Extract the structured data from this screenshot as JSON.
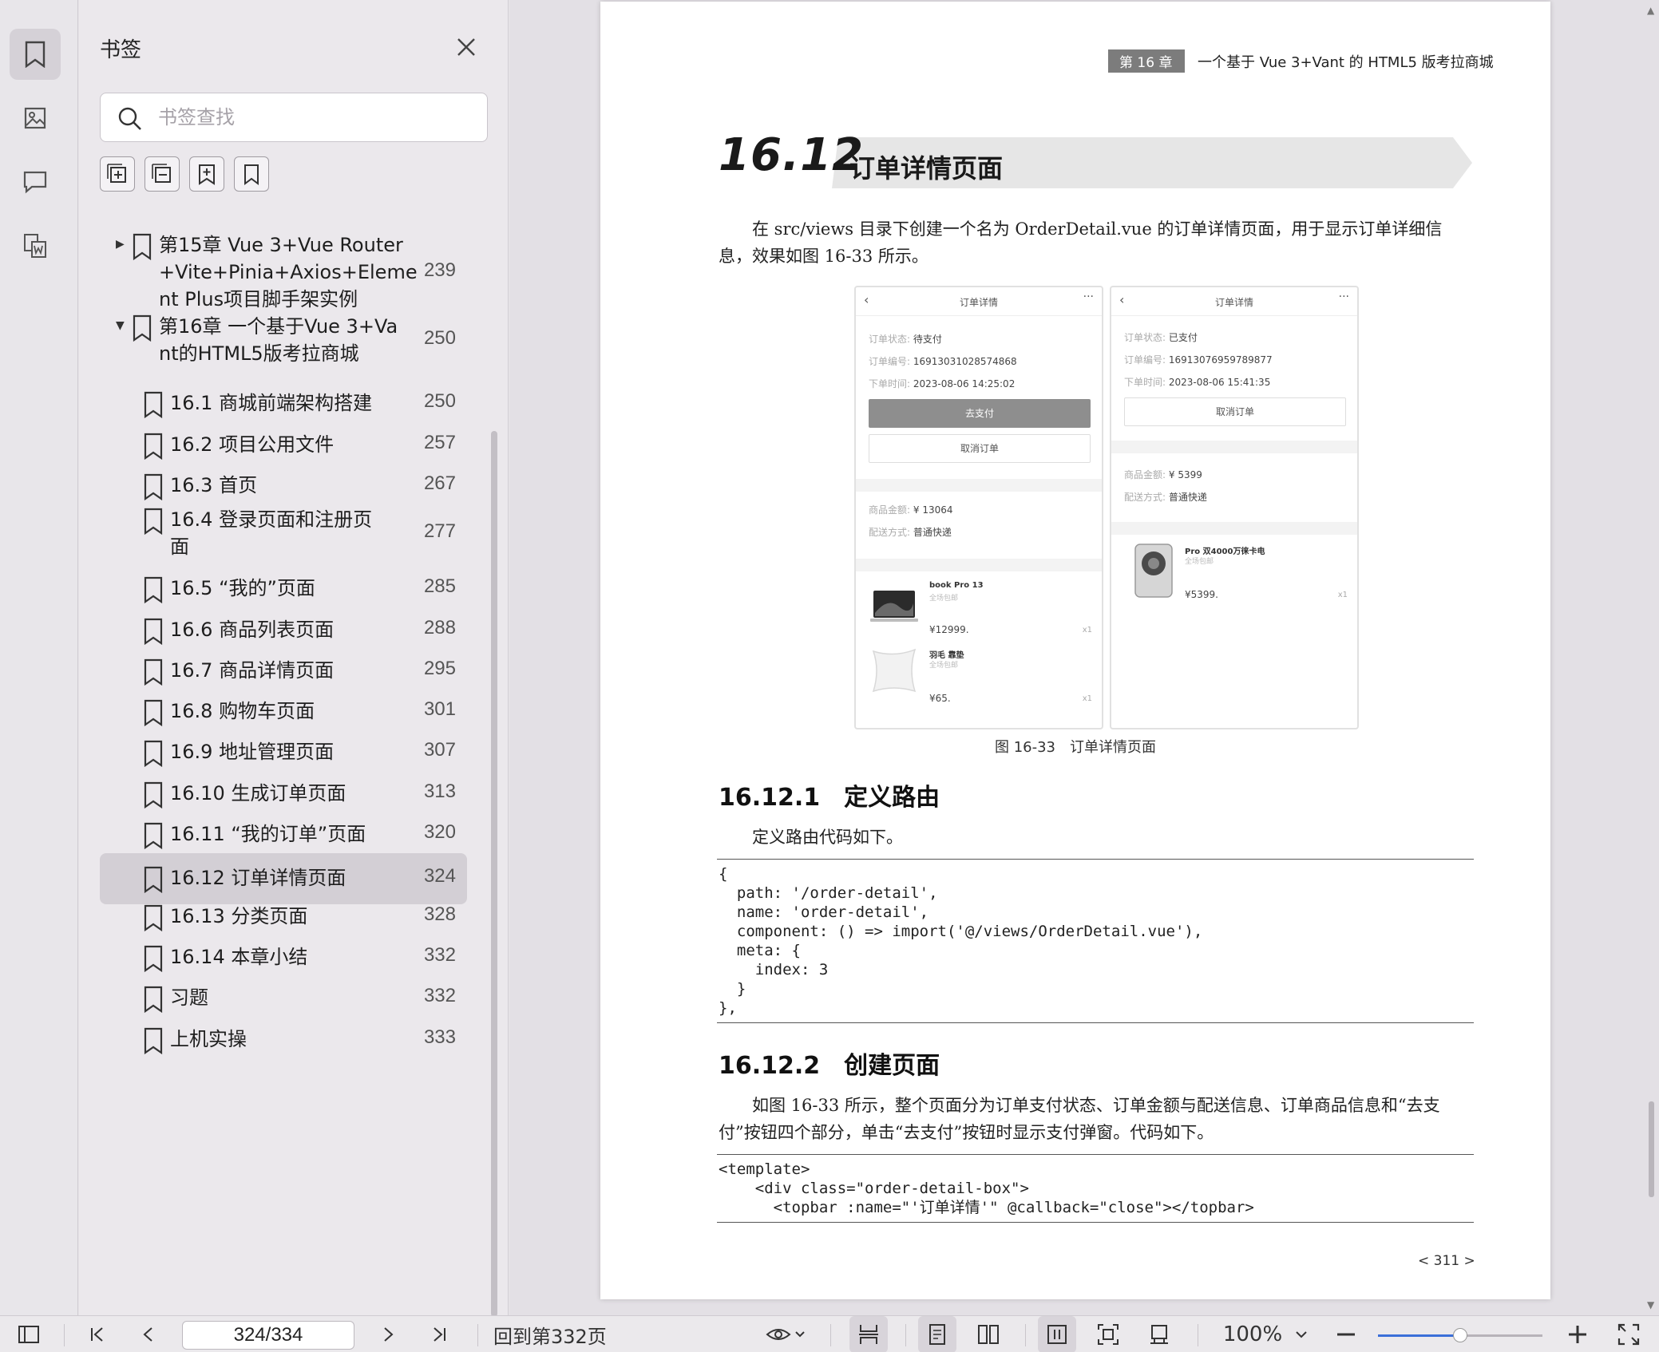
{
  "sidebar": {
    "title": "书签",
    "search_placeholder": "书签查找",
    "rail_icons": [
      "bookmark-icon",
      "image-icon",
      "comment-icon",
      "word-convert-icon"
    ],
    "tool_icons": [
      "expand-all-icon",
      "collapse-all-icon",
      "add-bookmark-icon",
      "bookmark-icon"
    ],
    "items": [
      {
        "level": 0,
        "toggle": "collapsed",
        "lines": [
          "第15章 Vue 3+Vue Router",
          "+Vite+Pinia+Axios+Eleme",
          "nt Plus项目脚手架实例"
        ],
        "page": "239"
      },
      {
        "level": 0,
        "toggle": "expanded",
        "lines": [
          "第16章 一个基于Vue 3+Va",
          "nt的HTML5版考拉商城"
        ],
        "page": "250"
      },
      {
        "level": 1,
        "lines": [
          "16.1 商城前端架构搭建"
        ],
        "page": "250"
      },
      {
        "level": 1,
        "lines": [
          "16.2 项目公用文件"
        ],
        "page": "257"
      },
      {
        "level": 1,
        "lines": [
          "16.3 首页"
        ],
        "page": "267"
      },
      {
        "level": 1,
        "lines": [
          "16.4 登录页面和注册页",
          "面"
        ],
        "page": "277"
      },
      {
        "level": 1,
        "lines": [
          "16.5 “我的”页面"
        ],
        "page": "285"
      },
      {
        "level": 1,
        "lines": [
          "16.6 商品列表页面"
        ],
        "page": "288"
      },
      {
        "level": 1,
        "lines": [
          "16.7 商品详情页面"
        ],
        "page": "295"
      },
      {
        "level": 1,
        "lines": [
          "16.8 购物车页面"
        ],
        "page": "301"
      },
      {
        "level": 1,
        "lines": [
          "16.9 地址管理页面"
        ],
        "page": "307"
      },
      {
        "level": 1,
        "lines": [
          "16.10 生成订单页面"
        ],
        "page": "313"
      },
      {
        "level": 1,
        "lines": [
          "16.11 “我的订单”页面"
        ],
        "page": "320"
      },
      {
        "level": 1,
        "lines": [
          "16.12 订单详情页面"
        ],
        "page": "324",
        "active": true
      },
      {
        "level": 1,
        "lines": [
          "16.13 分类页面"
        ],
        "page": "328"
      },
      {
        "level": 1,
        "lines": [
          "16.14 本章小结"
        ],
        "page": "332"
      },
      {
        "level": 1,
        "lines": [
          "习题"
        ],
        "page": "332"
      },
      {
        "level": 1,
        "lines": [
          "上机实操"
        ],
        "page": "333"
      }
    ]
  },
  "page": {
    "chapter_tag": "第 16 章",
    "header_title": "一个基于 Vue 3+Vant 的 HTML5 版考拉商城",
    "section_number": "16.12",
    "section_title": "订单详情页面",
    "intro": "在 src/views 目录下创建一个名为 OrderDetail.vue 的订单详情页面，用于显示订单详细信息，效果如图 16-33 所示。",
    "figure": {
      "caption": "图 16-33　订单详情页面",
      "left": {
        "title": "订单详情",
        "status_k": "订单状态:",
        "status_v": "待支付",
        "no_k": "订单编号:",
        "no_v": "16913031028574868",
        "time_k": "下单时间:",
        "time_v": "2023-08-06 14:25:02",
        "pay": "去支付",
        "cancel": "取消订单",
        "amount_k": "商品金额:",
        "amount_v": "¥ 13064",
        "ship_k": "配送方式:",
        "ship_v": "普通快递",
        "goods": [
          {
            "name": "book Pro 13",
            "sub": "全场包邮",
            "price": "¥12999.",
            "qty": "x1"
          },
          {
            "name": "羽毛 靠垫",
            "sub": "全场包邮",
            "price": "¥65.",
            "qty": "x1"
          }
        ]
      },
      "right": {
        "title": "订单详情",
        "status_k": "订单状态:",
        "status_v": "已支付",
        "no_k": "订单编号:",
        "no_v": "16913076959789877",
        "time_k": "下单时间:",
        "time_v": "2023-08-06 15:41:35",
        "cancel": "取消订单",
        "amount_k": "商品金额:",
        "amount_v": "¥ 5399",
        "ship_k": "配送方式:",
        "ship_v": "普通快递",
        "goods": [
          {
            "name": "Pro 双4000万徕卡电",
            "sub": "全场包邮",
            "price": "¥5399.",
            "qty": "x1"
          }
        ]
      }
    },
    "h2_1": "16.12.1　定义路由",
    "para_route": "定义路由代码如下。",
    "code1": "{\n  path: '/order-detail',\n  name: 'order-detail',\n  component: () => import('@/views/OrderDetail.vue'),\n  meta: {\n    index: 3\n  }\n},",
    "h2_2": "16.12.2　创建页面",
    "para_page": "如图 16-33 所示，整个页面分为订单支付状态、订单金额与配送信息、订单商品信息和“去支付”按钮四个部分，单击“去支付”按钮时显示支付弹窗。代码如下。",
    "code2": "<template>\n    <div class=\"order-detail-box\">\n      <topbar :name=\"'订单详情'\" @callback=\"close\"></topbar>",
    "page_footer": "< 311 >"
  },
  "toolbar": {
    "page_indicator": "324/334",
    "back_link": "回到第332页",
    "zoom": "100%",
    "zoom_level": 0.5
  }
}
